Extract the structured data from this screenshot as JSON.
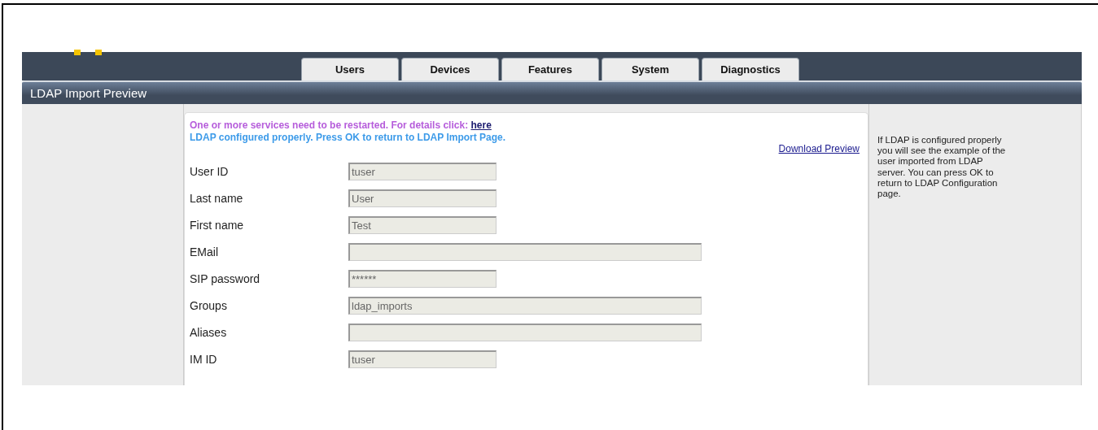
{
  "tabs": [
    {
      "label": "Users",
      "selected": false
    },
    {
      "label": "Devices",
      "selected": false
    },
    {
      "label": "Features",
      "selected": false
    },
    {
      "label": "System",
      "selected": false
    },
    {
      "label": "Diagnostics",
      "selected": false
    }
  ],
  "page_title": "LDAP Import Preview",
  "messages": {
    "restart_text": "One or more services need to be restarted. For details click:",
    "restart_link": "here",
    "status": "LDAP configured properly. Press OK to return to LDAP Import Page."
  },
  "download_link": "Download Preview",
  "fields": [
    {
      "label": "User ID",
      "value": "tuser",
      "kind": "short"
    },
    {
      "label": "Last name",
      "value": "User",
      "kind": "short"
    },
    {
      "label": "First name",
      "value": "Test",
      "kind": "short"
    },
    {
      "label": "EMail",
      "kind": "long"
    },
    {
      "label": "SIP password",
      "value": "******",
      "kind": "short"
    },
    {
      "label": "Groups",
      "value": "ldap_imports",
      "kind": "long"
    },
    {
      "label": "Aliases",
      "kind": "long"
    },
    {
      "label": "IM ID",
      "value": "tuser",
      "kind": "short"
    }
  ],
  "help_text": "If LDAP is configured properly you will see the example of the user imported from LDAP server. You can press OK to return to LDAP Configuration page."
}
